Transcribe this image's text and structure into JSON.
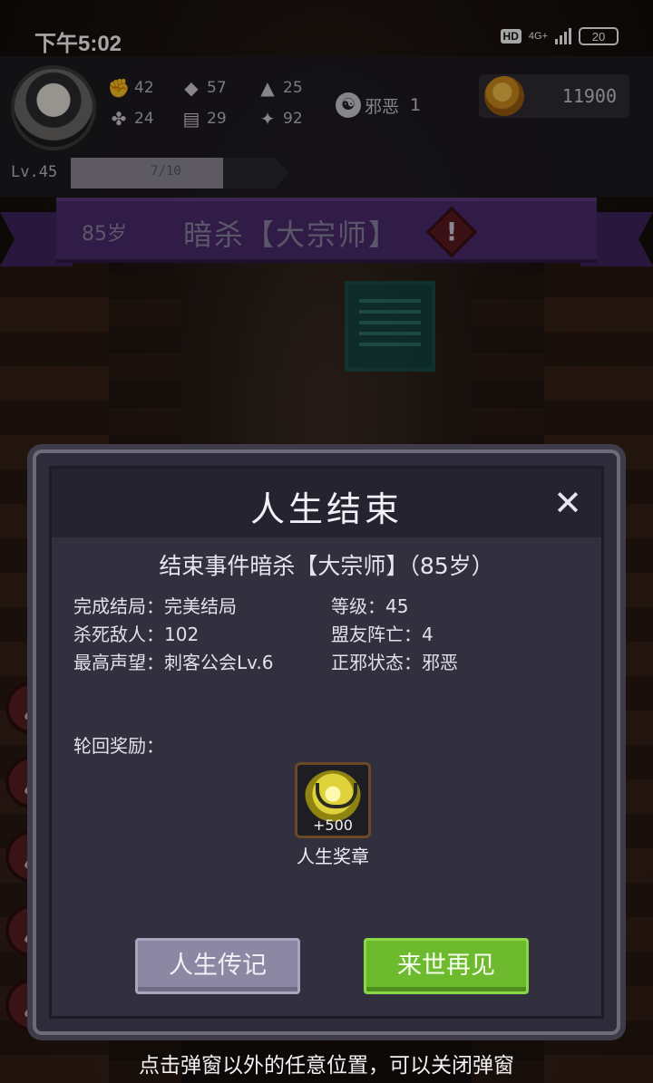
{
  "status_bar": {
    "time": "下午5:02",
    "network": "4G+",
    "battery": "20"
  },
  "player": {
    "stats": [
      {
        "icon": "fist-icon",
        "value": "42"
      },
      {
        "icon": "blade-icon",
        "value": "57"
      },
      {
        "icon": "wizard-hat-icon",
        "value": "25"
      },
      {
        "icon": "clover-icon",
        "value": "24"
      },
      {
        "icon": "book-icon",
        "value": "29"
      },
      {
        "icon": "wings-icon",
        "value": "92"
      }
    ],
    "alignment_label": "邪恶",
    "alignment_value": "1",
    "gold": "11900",
    "level": "Lv.45",
    "xp_text": "7/10",
    "xp_progress": 0.7
  },
  "ribbon": {
    "age": "85岁",
    "title": "暗杀【大宗师】"
  },
  "modal": {
    "title": "人生结束",
    "event": "结束事件暗杀【大宗师】（85岁）",
    "facts": [
      "完成结局：完美结局",
      "等级：45",
      "杀死敌人：102",
      "盟友阵亡：4",
      "最高声望：刺客公会Lv.6",
      "正邪状态：邪恶"
    ],
    "reward_label": "轮回奖励：",
    "reward": {
      "name": "人生奖章",
      "count": "+500"
    },
    "button_bio": "人生传记",
    "button_next": "来世再见"
  },
  "hint": "点击弹窗以外的任意位置，可以关闭弹窗",
  "colors": {
    "ribbon": "#4a2b6e",
    "modal_bg": "#32303f",
    "button_next": "#6dba2f",
    "button_bio": "#8c88a4"
  }
}
